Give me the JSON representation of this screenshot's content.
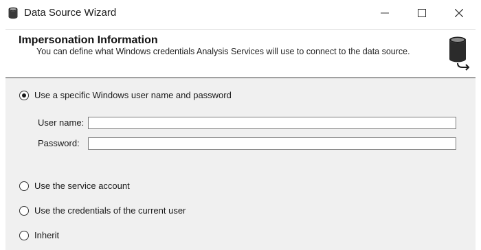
{
  "window": {
    "title": "Data Source Wizard"
  },
  "header": {
    "title": "Impersonation Information",
    "description": "You can define what Windows credentials Analysis Services will use to connect to the data source."
  },
  "options": {
    "specific_user": {
      "label": "Use a specific Windows user name and password",
      "checked": true
    },
    "service_account": {
      "label": "Use the service account",
      "checked": false
    },
    "current_user": {
      "label": "Use the credentials of the current user",
      "checked": false
    },
    "inherit": {
      "label": "Inherit",
      "checked": false
    }
  },
  "fields": {
    "username": {
      "label": "User name:",
      "value": ""
    },
    "password": {
      "label": "Password:",
      "value": ""
    }
  },
  "icons": {
    "app": "database-icon",
    "header": "database-arrow-icon",
    "minimize": "minimize-icon",
    "maximize": "maximize-icon",
    "close": "close-icon"
  }
}
